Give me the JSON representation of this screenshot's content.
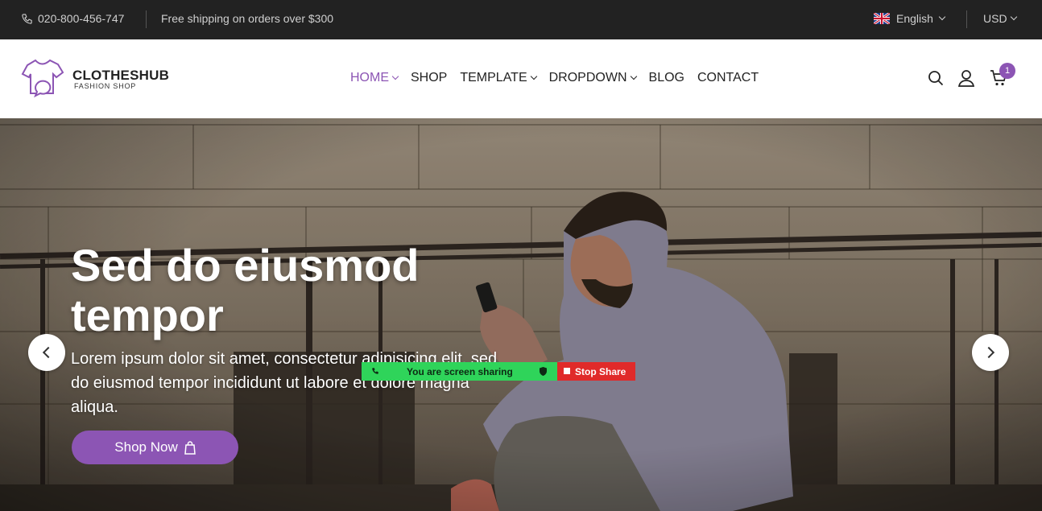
{
  "topbar": {
    "phone": "020-800-456-747",
    "shipping": "Free shipping on orders over $300",
    "language": "English",
    "currency": "USD"
  },
  "header": {
    "brand": "CLOTHESHUB",
    "tagline": "FASHION SHOP",
    "nav": [
      {
        "label": "HOME",
        "dropdown": true,
        "active": true
      },
      {
        "label": "SHOP",
        "dropdown": false,
        "active": false
      },
      {
        "label": "TEMPLATE",
        "dropdown": true,
        "active": false
      },
      {
        "label": "DROPDOWN",
        "dropdown": true,
        "active": false
      },
      {
        "label": "BLOG",
        "dropdown": false,
        "active": false
      },
      {
        "label": "CONTACT",
        "dropdown": false,
        "active": false
      }
    ],
    "cart_count": "1",
    "icons": [
      "search-icon",
      "user-icon",
      "cart-icon"
    ]
  },
  "hero": {
    "title": "Sed do eiusmod tempor",
    "text": "Lorem ipsum dolor sit amet, consectetur adipisicing elit, sed do eiusmod tempor incididunt ut labore et dolore magna aliqua.",
    "button": "Shop Now"
  },
  "screen_share": {
    "status": "You are screen sharing",
    "stop": "Stop Share"
  },
  "colors": {
    "accent": "#8c55b4",
    "topbar_bg": "#222222",
    "share_green": "#2fd45a",
    "stop_red": "#e02a2a"
  }
}
